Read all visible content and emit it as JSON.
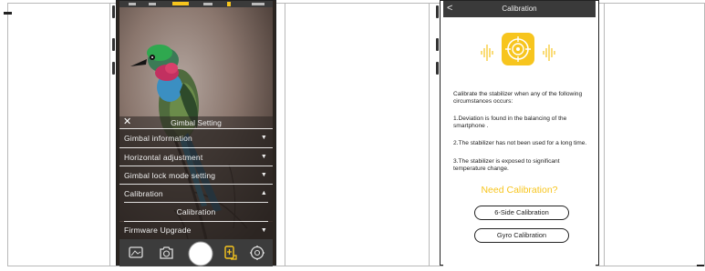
{
  "gimbal_screen": {
    "title": "Gimbal Setting",
    "menu": [
      {
        "label": "Gimbal information",
        "caret": "▼"
      },
      {
        "label": "Horizontal adjustment",
        "caret": "▼"
      },
      {
        "label": "Gimbal lock mode setting",
        "caret": "▼"
      },
      {
        "label": "Calibration",
        "caret": "▲"
      }
    ],
    "submenu_item": "Calibration",
    "firmware_label": "Firmware Upgrade",
    "firmware_caret": "▼"
  },
  "calibration_screen": {
    "title": "Calibration",
    "intro": "Calibrate the stabilizer when any of the following circumstances occurs:",
    "items": [
      "1.Deviation is found in the balancing of the smartphone .",
      "2.The stabilizer has not been used for a long time.",
      "3.The stabilizer is exposed to significant temperature change."
    ],
    "prompt": "Need Calibration?",
    "btn_six_side": "6-Side Calibration",
    "btn_gyro": "Gyro Calibration"
  },
  "colors": {
    "accent": "#f7c51e",
    "dark": "#3a3a3a"
  },
  "icons": [
    "back-icon",
    "close-icon",
    "target-icon",
    "vibration-icon",
    "gallery-icon",
    "camera-icon",
    "shutter-icon",
    "gimbal-icon",
    "settings-icon"
  ]
}
